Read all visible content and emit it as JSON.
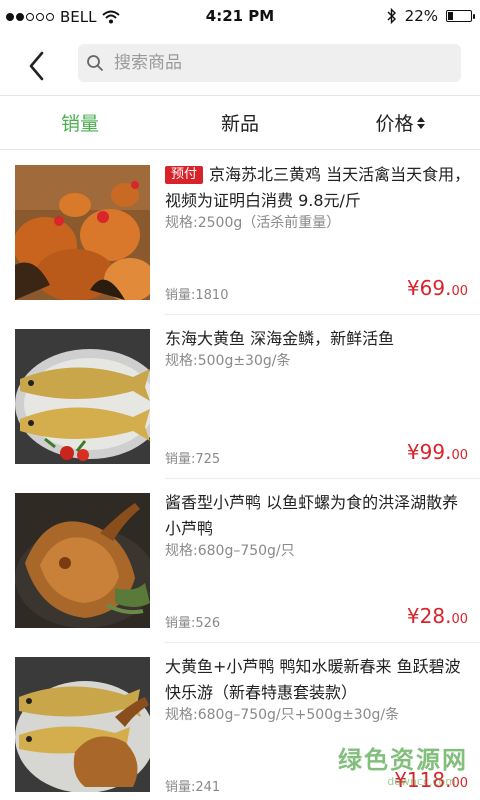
{
  "status": {
    "carrier": "BELL",
    "time": "4:21 PM",
    "battery": "22%",
    "battery_level": 0.22
  },
  "search": {
    "placeholder": "搜索商品"
  },
  "tabs": [
    {
      "label": "销量",
      "active": true
    },
    {
      "label": "新品",
      "active": false
    },
    {
      "label": "价格",
      "active": false
    }
  ],
  "products": [
    {
      "badge": "预付",
      "title": "京海苏北三黄鸡 当天活禽当天食用，视频为证明白消费 9.8元/斤",
      "spec": "规格:2500g（活杀前重量）",
      "sales": "销量:1810",
      "price_int": "¥69.",
      "price_cents": "00"
    },
    {
      "badge": "",
      "title": "东海大黄鱼 深海金鳞，新鲜活鱼",
      "spec": "规格:500g±30g/条",
      "sales": "销量:725",
      "price_int": "¥99.",
      "price_cents": "00"
    },
    {
      "badge": "",
      "title": "酱香型小芦鸭 以鱼虾螺为食的洪泽湖散养小芦鸭",
      "spec": "规格:680g–750g/只",
      "sales": "销量:526",
      "price_int": "¥28.",
      "price_cents": "00"
    },
    {
      "badge": "",
      "title": "大黄鱼+小芦鸭 鸭知水暖新春来 鱼跃碧波快乐游（新春特惠套装款）",
      "spec": "规格:680g–750g/只+500g±30g/条",
      "sales": "销量:241",
      "price_int": "¥118.",
      "price_cents": "00"
    }
  ],
  "watermark": {
    "title": "绿色资源网",
    "sub": "downcc.com"
  },
  "colors": {
    "accent_green": "#4caf50",
    "price_red": "#d9232a"
  }
}
